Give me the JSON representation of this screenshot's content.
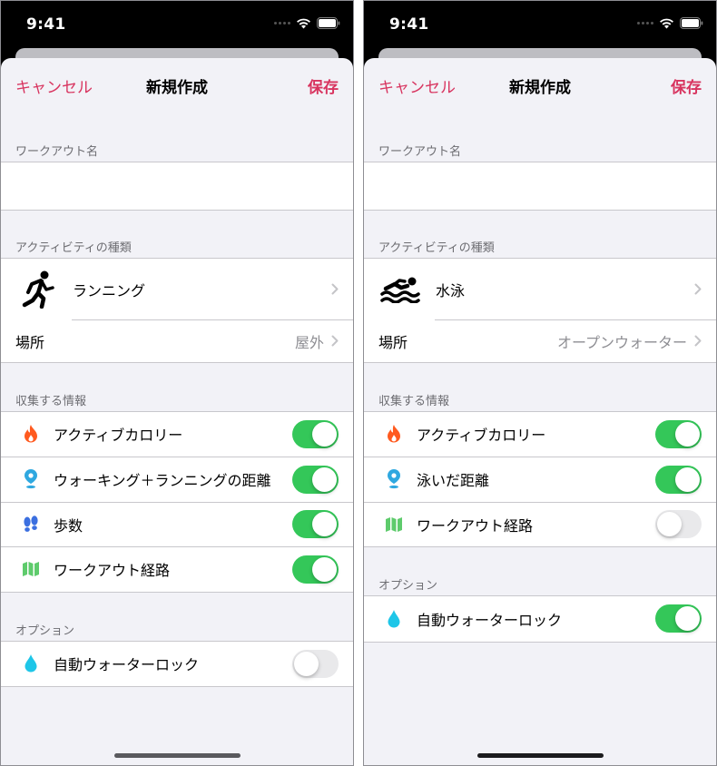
{
  "left": {
    "status_time": "9:41",
    "nav": {
      "cancel": "キャンセル",
      "title": "新規作成",
      "save": "保存"
    },
    "workout_name": {
      "header": "ワークアウト名",
      "value": "",
      "placeholder": ""
    },
    "activity": {
      "header": "アクティビティの種類",
      "type_icon": "running-figure-icon",
      "type_label": "ランニング",
      "location_label": "場所",
      "location_value": "屋外"
    },
    "collect": {
      "header": "収集する情報",
      "rows": [
        {
          "label": "アクティブカロリー",
          "icon": "flame-icon",
          "icon_color": "#ff5a1f",
          "on": true
        },
        {
          "label": "ウォーキング＋ランニングの距離",
          "icon": "location-pin-icon",
          "icon_color": "#2fa8e0",
          "on": true
        },
        {
          "label": "歩数",
          "icon": "footsteps-icon",
          "icon_color": "#3b6fe0",
          "on": true
        },
        {
          "label": "ワークアウト経路",
          "icon": "map-icon",
          "icon_color": "#5ecb6c",
          "on": true
        }
      ]
    },
    "options": {
      "header": "オプション",
      "rows": [
        {
          "label": "自動ウォーターロック",
          "icon": "water-drop-icon",
          "icon_color": "#1ec6e8",
          "on": false
        }
      ]
    }
  },
  "right": {
    "status_time": "9:41",
    "nav": {
      "cancel": "キャンセル",
      "title": "新規作成",
      "save": "保存"
    },
    "workout_name": {
      "header": "ワークアウト名",
      "value": "",
      "placeholder": ""
    },
    "activity": {
      "header": "アクティビティの種類",
      "type_icon": "swimming-figure-icon",
      "type_label": "水泳",
      "location_label": "場所",
      "location_value": "オープンウォーター"
    },
    "collect": {
      "header": "収集する情報",
      "rows": [
        {
          "label": "アクティブカロリー",
          "icon": "flame-icon",
          "icon_color": "#ff5a1f",
          "on": true
        },
        {
          "label": "泳いだ距離",
          "icon": "location-pin-icon",
          "icon_color": "#2fa8e0",
          "on": true
        },
        {
          "label": "ワークアウト経路",
          "icon": "map-icon",
          "icon_color": "#5ecb6c",
          "on": false
        }
      ]
    },
    "options": {
      "header": "オプション",
      "rows": [
        {
          "label": "自動ウォーターロック",
          "icon": "water-drop-icon",
          "icon_color": "#1ec6e8",
          "on": true
        }
      ]
    }
  }
}
